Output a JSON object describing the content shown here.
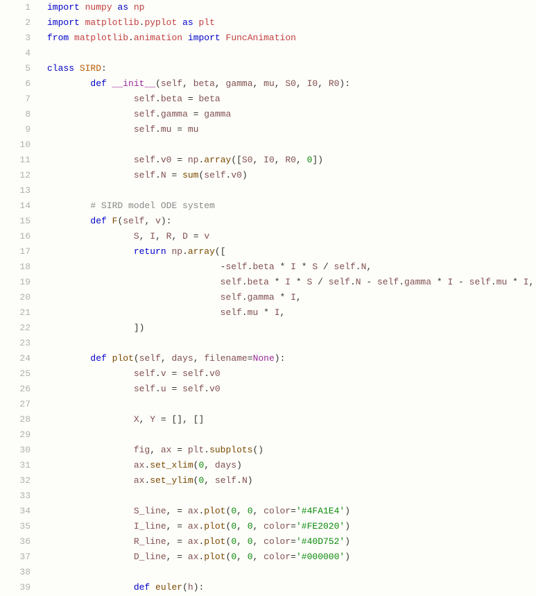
{
  "lines": [
    {
      "num": "1",
      "html": "<span class='kw'>import</span> <span class='name'>numpy</span> <span class='kw'>as</span> <span class='name'>np</span>"
    },
    {
      "num": "2",
      "html": "<span class='kw'>import</span> <span class='name'>matplotlib</span>.<span class='name'>pyplot</span> <span class='kw'>as</span> <span class='name'>plt</span>"
    },
    {
      "num": "3",
      "html": "<span class='kw'>from</span> <span class='name'>matplotlib</span>.<span class='name'>animation</span> <span class='kw'>import</span> <span class='name'>FuncAnimation</span>"
    },
    {
      "num": "4",
      "html": ""
    },
    {
      "num": "5",
      "html": "<span class='kw'>class</span> <span class='cls'>SIRD</span>:"
    },
    {
      "num": "6",
      "html": "        <span class='kw'>def</span> <span class='dunder'>__init__</span>(<span class='self'>self</span>, <span class='self'>beta</span>, <span class='self'>gamma</span>, <span class='self'>mu</span>, <span class='self'>S0</span>, <span class='self'>I0</span>, <span class='self'>R0</span>):"
    },
    {
      "num": "7",
      "html": "                <span class='self'>self</span>.<span class='attr'>beta</span> = <span class='self'>beta</span>"
    },
    {
      "num": "8",
      "html": "                <span class='self'>self</span>.<span class='attr'>gamma</span> = <span class='self'>gamma</span>"
    },
    {
      "num": "9",
      "html": "                <span class='self'>self</span>.<span class='attr'>mu</span> = <span class='self'>mu</span>"
    },
    {
      "num": "10",
      "html": ""
    },
    {
      "num": "11",
      "html": "                <span class='self'>self</span>.<span class='attr'>v0</span> = <span class='self'>np</span>.<span class='call'>array</span>([<span class='self'>S0</span>, <span class='self'>I0</span>, <span class='self'>R0</span>, <span class='num'>0</span>])"
    },
    {
      "num": "12",
      "html": "                <span class='self'>self</span>.<span class='attr'>N</span> = <span class='builtin'>sum</span>(<span class='self'>self</span>.<span class='attr'>v0</span>)"
    },
    {
      "num": "13",
      "html": ""
    },
    {
      "num": "14",
      "html": "        <span class='comment'># SIRD model ODE system</span>"
    },
    {
      "num": "15",
      "html": "        <span class='kw'>def</span> <span class='call'>F</span>(<span class='self'>self</span>, <span class='self'>v</span>):"
    },
    {
      "num": "16",
      "html": "                <span class='self'>S</span>, <span class='self'>I</span>, <span class='self'>R</span>, <span class='self'>D</span> = <span class='self'>v</span>"
    },
    {
      "num": "17",
      "html": "                <span class='kw'>return</span> <span class='self'>np</span>.<span class='call'>array</span>(["
    },
    {
      "num": "18",
      "html": "                                -<span class='self'>self</span>.<span class='attr'>beta</span> * <span class='self'>I</span> * <span class='self'>S</span> / <span class='self'>self</span>.<span class='attr'>N</span>,"
    },
    {
      "num": "19",
      "html": "                                <span class='self'>self</span>.<span class='attr'>beta</span> * <span class='self'>I</span> * <span class='self'>S</span> / <span class='self'>self</span>.<span class='attr'>N</span> - <span class='self'>self</span>.<span class='attr'>gamma</span> * <span class='self'>I</span> - <span class='self'>self</span>.<span class='attr'>mu</span> * <span class='self'>I</span>,"
    },
    {
      "num": "20",
      "html": "                                <span class='self'>self</span>.<span class='attr'>gamma</span> * <span class='self'>I</span>,"
    },
    {
      "num": "21",
      "html": "                                <span class='self'>self</span>.<span class='attr'>mu</span> * <span class='self'>I</span>,"
    },
    {
      "num": "22",
      "html": "                ])"
    },
    {
      "num": "23",
      "html": ""
    },
    {
      "num": "24",
      "html": "        <span class='kw'>def</span> <span class='call'>plot</span>(<span class='self'>self</span>, <span class='self'>days</span>, <span class='self'>filename</span>=<span class='const'>None</span>):"
    },
    {
      "num": "25",
      "html": "                <span class='self'>self</span>.<span class='attr'>v</span> = <span class='self'>self</span>.<span class='attr'>v0</span>"
    },
    {
      "num": "26",
      "html": "                <span class='self'>self</span>.<span class='attr'>u</span> = <span class='self'>self</span>.<span class='attr'>v0</span>"
    },
    {
      "num": "27",
      "html": ""
    },
    {
      "num": "28",
      "html": "                <span class='self'>X</span>, <span class='self'>Y</span> = [], []"
    },
    {
      "num": "29",
      "html": ""
    },
    {
      "num": "30",
      "html": "                <span class='self'>fig</span>, <span class='self'>ax</span> = <span class='self'>plt</span>.<span class='call'>subplots</span>()"
    },
    {
      "num": "31",
      "html": "                <span class='self'>ax</span>.<span class='call'>set_xlim</span>(<span class='num'>0</span>, <span class='self'>days</span>)"
    },
    {
      "num": "32",
      "html": "                <span class='self'>ax</span>.<span class='call'>set_ylim</span>(<span class='num'>0</span>, <span class='self'>self</span>.<span class='attr'>N</span>)"
    },
    {
      "num": "33",
      "html": ""
    },
    {
      "num": "34",
      "html": "                <span class='self'>S_line</span>, = <span class='self'>ax</span>.<span class='call'>plot</span>(<span class='num'>0</span>, <span class='num'>0</span>, <span class='self'>color</span>=<span class='str'>'#4FA1E4'</span>)"
    },
    {
      "num": "35",
      "html": "                <span class='self'>I_line</span>, = <span class='self'>ax</span>.<span class='call'>plot</span>(<span class='num'>0</span>, <span class='num'>0</span>, <span class='self'>color</span>=<span class='str'>'#FE2020'</span>)"
    },
    {
      "num": "36",
      "html": "                <span class='self'>R_line</span>, = <span class='self'>ax</span>.<span class='call'>plot</span>(<span class='num'>0</span>, <span class='num'>0</span>, <span class='self'>color</span>=<span class='str'>'#40D752'</span>)"
    },
    {
      "num": "37",
      "html": "                <span class='self'>D_line</span>, = <span class='self'>ax</span>.<span class='call'>plot</span>(<span class='num'>0</span>, <span class='num'>0</span>, <span class='self'>color</span>=<span class='str'>'#000000'</span>)"
    },
    {
      "num": "38",
      "html": ""
    },
    {
      "num": "39",
      "html": "                <span class='kw'>def</span> <span class='call'>euler</span>(<span class='self'>h</span>):"
    }
  ]
}
